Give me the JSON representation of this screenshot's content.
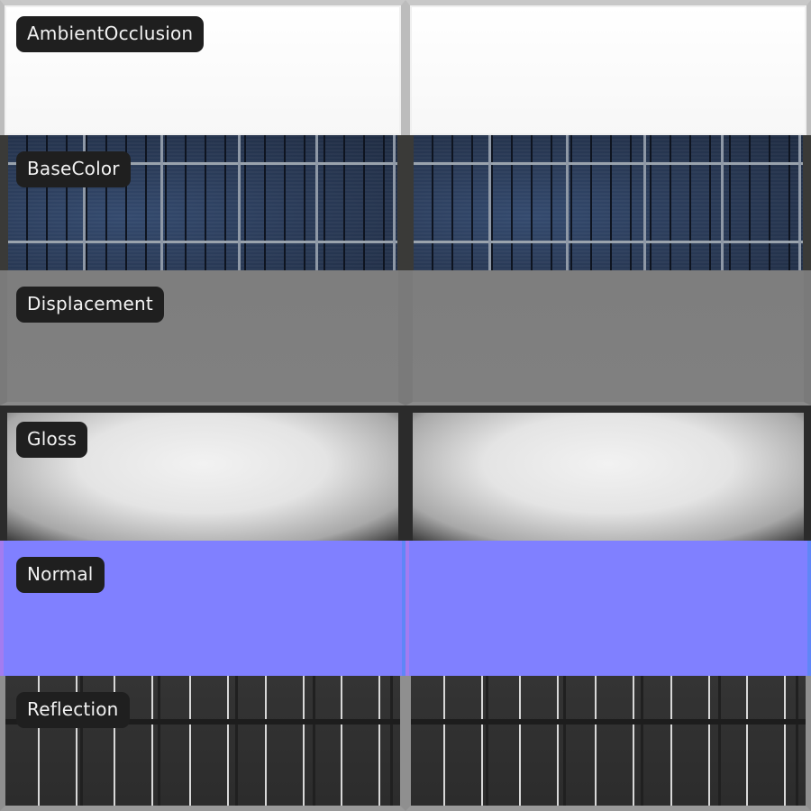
{
  "maps": [
    {
      "id": "ao",
      "label": "AmbientOcclusion"
    },
    {
      "id": "base",
      "label": "BaseColor"
    },
    {
      "id": "disp",
      "label": "Displacement"
    },
    {
      "id": "gloss",
      "label": "Gloss"
    },
    {
      "id": "normal",
      "label": "Normal"
    },
    {
      "id": "refl",
      "label": "Reflection"
    }
  ],
  "colors": {
    "label_bg": "#1f1f1f",
    "label_text": "#f2f2f2",
    "normal": "#8080ff",
    "displacement": "#808080",
    "base_panel": "#2a3b58"
  }
}
